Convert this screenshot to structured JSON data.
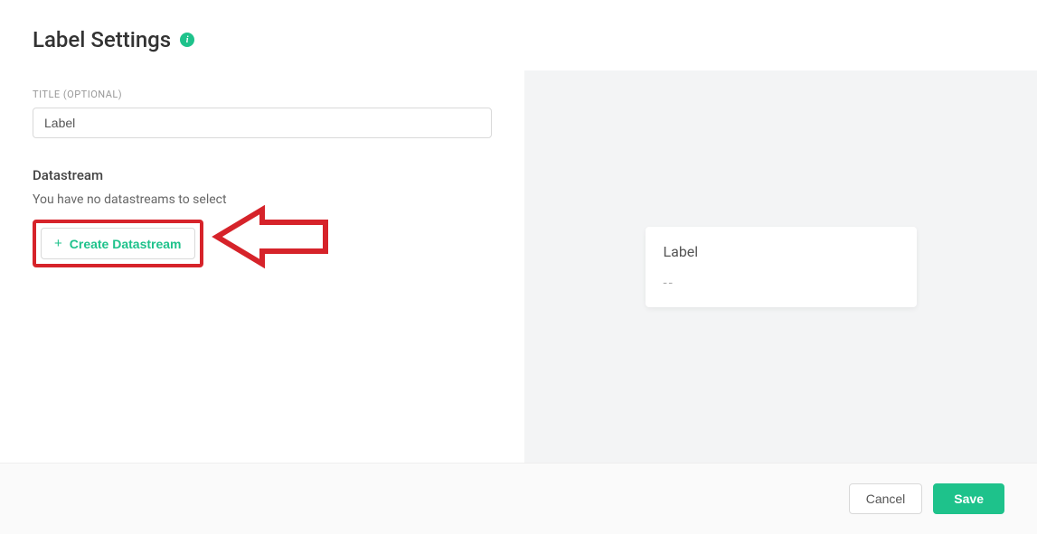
{
  "page": {
    "title": "Label Settings"
  },
  "form": {
    "title_label": "TITLE (OPTIONAL)",
    "title_value": "Label",
    "datastream_label": "Datastream",
    "datastream_empty_msg": "You have no datastreams to select",
    "create_datastream_label": "Create Datastream"
  },
  "preview": {
    "title": "Label",
    "value": "--"
  },
  "footer": {
    "cancel_label": "Cancel",
    "save_label": "Save"
  },
  "colors": {
    "accent": "#1ec28b",
    "annotation": "#d6232a"
  }
}
